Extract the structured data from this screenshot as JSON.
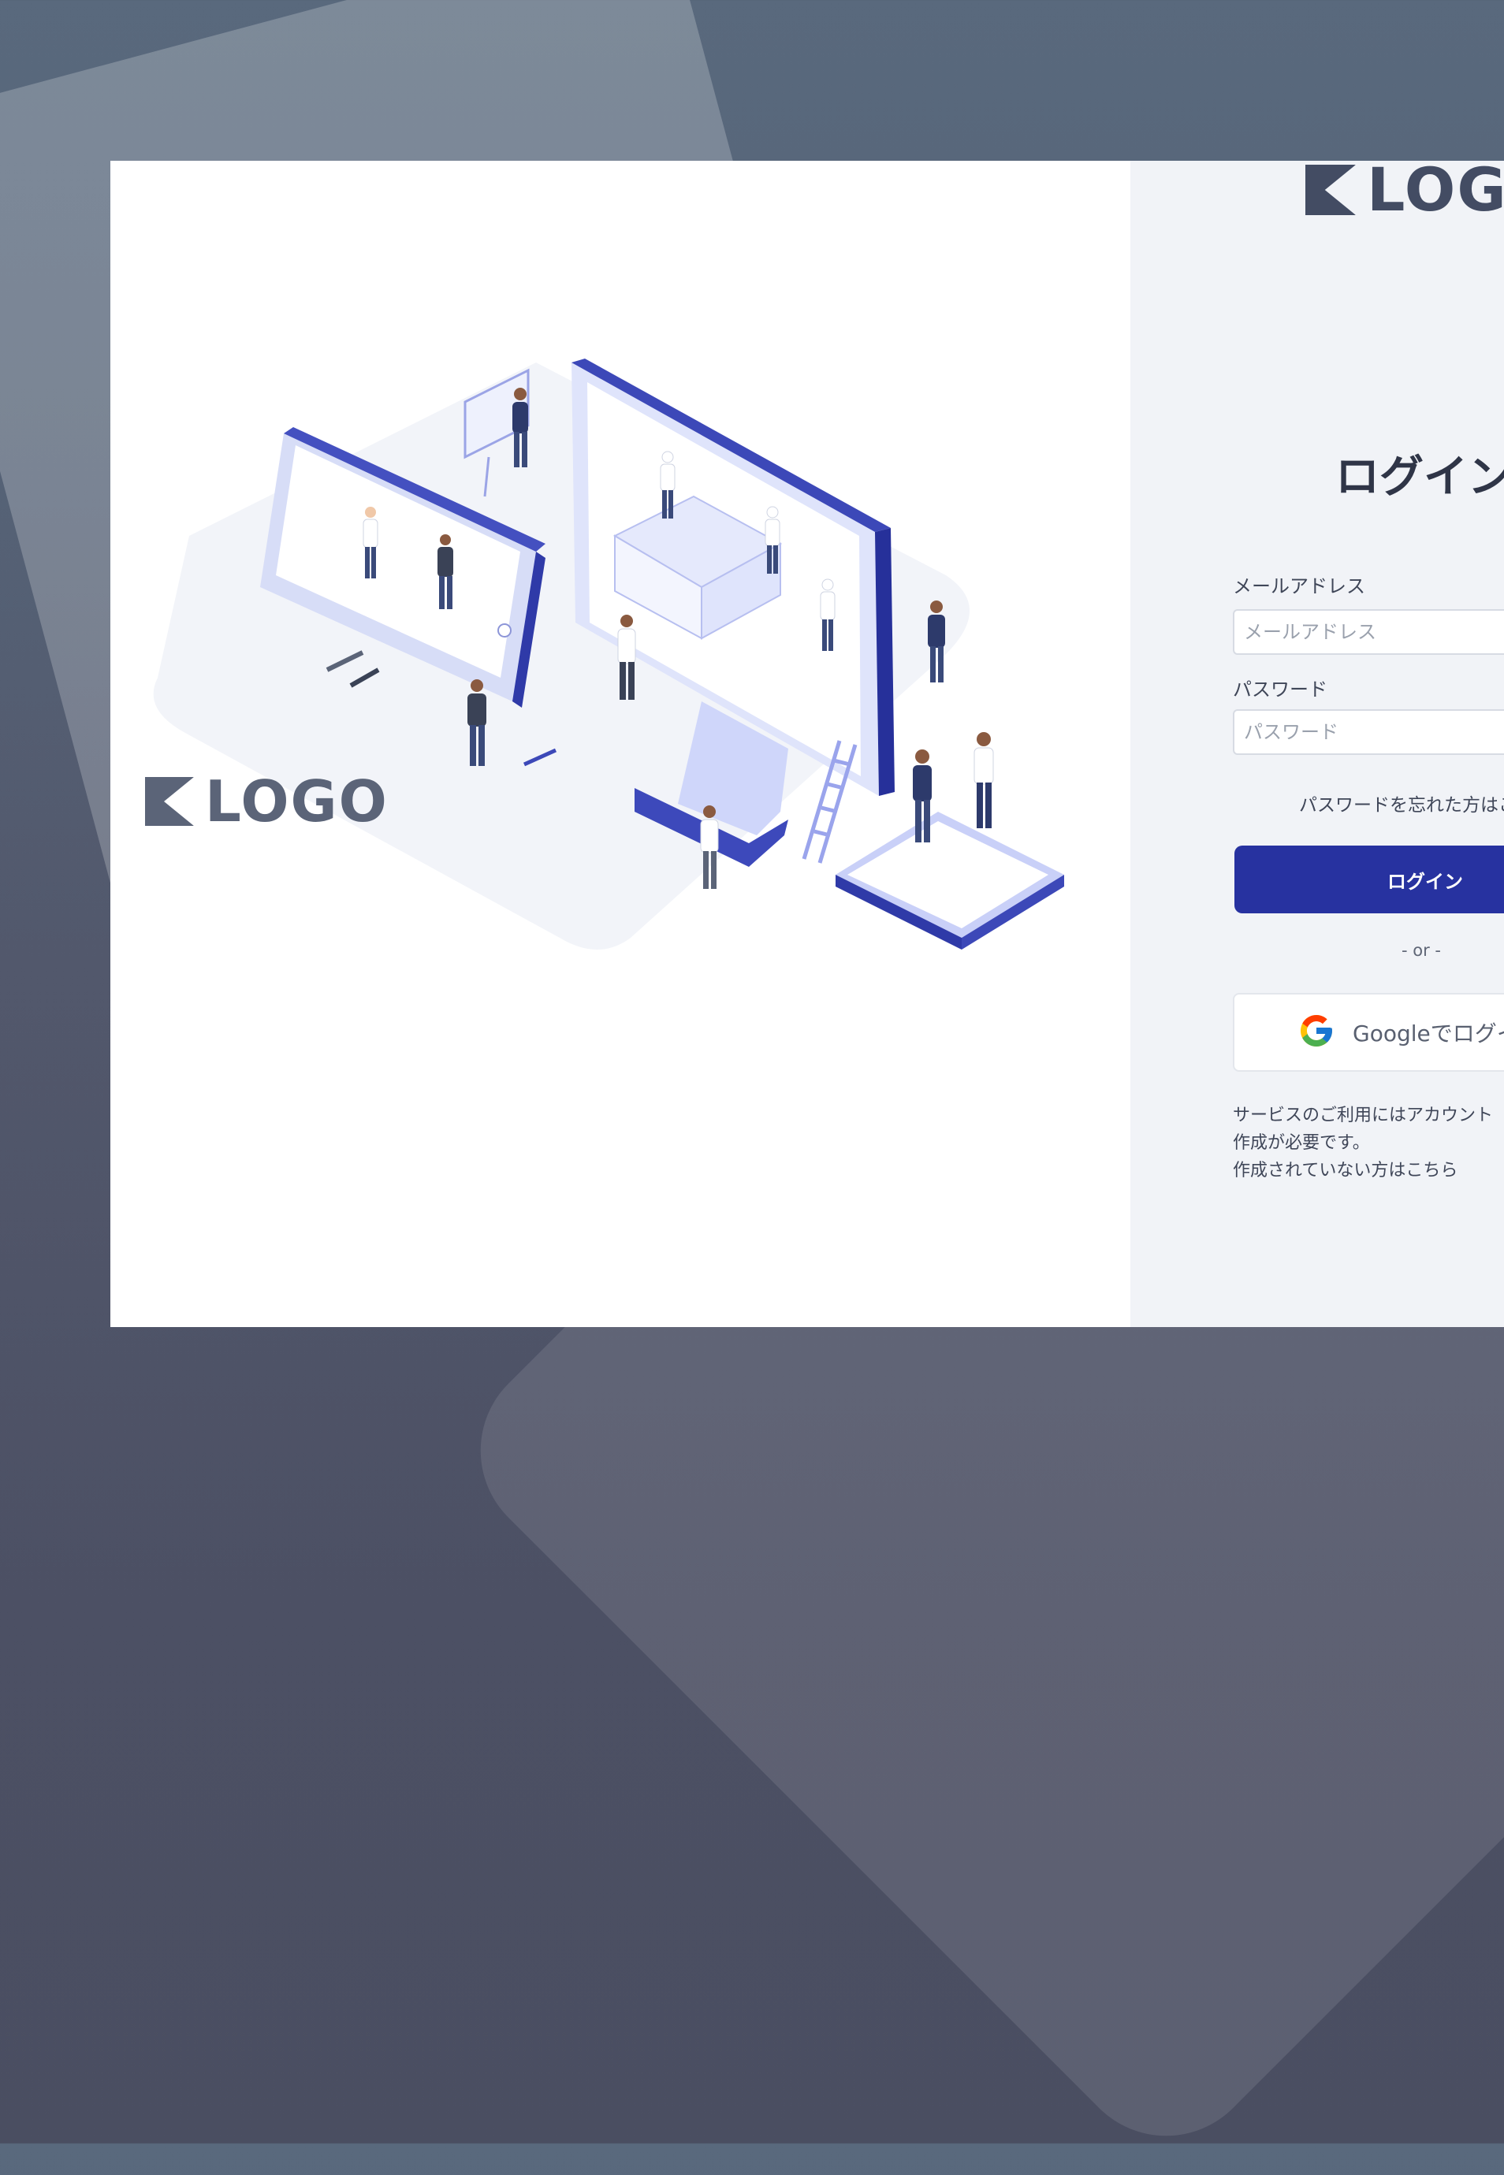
{
  "brand": {
    "logo_text": "LOGO"
  },
  "form": {
    "title": "ログイン",
    "email_label": "メールアドレス",
    "email_placeholder": "メールアドレス",
    "email_value": "",
    "password_label": "パスワード",
    "password_placeholder": "パスワード",
    "password_value": "",
    "forgot_link": "パスワードを忘れた方はこちら",
    "login_button": "ログイン",
    "or_divider": "- or -",
    "google_button": "Googleでログイン",
    "signup_line1": "サービスのご利用にはアカウント作成が必要です。",
    "signup_line2": "作成されていない方はこちら"
  },
  "colors": {
    "primary": "#2732a0",
    "form_background": "#f1f3f7",
    "page_background": "#52586c"
  }
}
